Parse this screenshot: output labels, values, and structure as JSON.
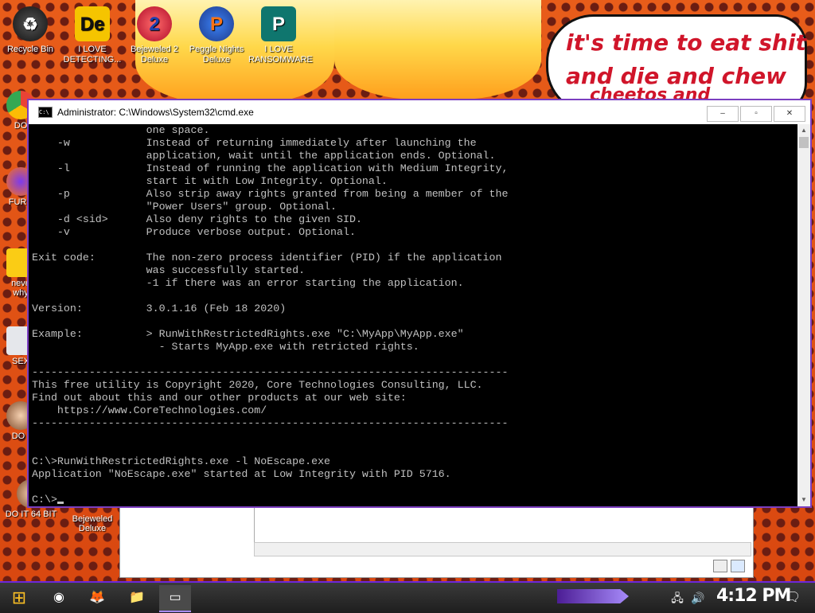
{
  "desktop": {
    "top_icons": [
      {
        "label": "Recycle Bin",
        "icon": "recycle-bin-icon",
        "glyph": "🗑"
      },
      {
        "label": "I LOVE DETECTING...",
        "icon": "detecting-app-icon",
        "glyph": "De"
      },
      {
        "label": "Bejeweled 2 Deluxe",
        "icon": "bejeweled-icon",
        "glyph": "2"
      },
      {
        "label": "Peggle Nights Deluxe",
        "icon": "peggle-icon",
        "glyph": "P"
      },
      {
        "label": "I LOVE RANSOMWARE",
        "icon": "ransomware-icon",
        "glyph": "P"
      }
    ],
    "left_icons": [
      {
        "label": "DO",
        "icon": "chrome-icon"
      },
      {
        "label": "FURR",
        "icon": "firefox-icon"
      },
      {
        "label": "neve why",
        "icon": "dc-icon"
      },
      {
        "label": "SEX",
        "icon": "h-app-icon"
      },
      {
        "label": "DO I",
        "icon": "face-icon"
      },
      {
        "label": "DO IT 64 BIT",
        "icon": "face-icon-2"
      },
      {
        "label": "Bejeweled Deluxe",
        "icon": "bejeweled-deluxe-icon"
      }
    ],
    "speech_bubble": {
      "line1": "it's time to eat shit",
      "line2": "and die and chew",
      "line3": "cheetos and"
    }
  },
  "cmd_window": {
    "title": "Administrator: C:\\Windows\\System32\\cmd.exe",
    "title_icon_text": "C:\\",
    "minimize": "–",
    "maximize": "▫",
    "close": "✕",
    "lines": [
      "                  one space.",
      "    -w            Instead of returning immediately after launching the",
      "                  application, wait until the application ends. Optional.",
      "    -l            Instead of running the application with Medium Integrity,",
      "                  start it with Low Integrity. Optional.",
      "    -p            Also strip away rights granted from being a member of the",
      "                  \"Power Users\" group. Optional.",
      "    -d <sid>      Also deny rights to the given SID.",
      "    -v            Produce verbose output. Optional.",
      "",
      "Exit code:        The non-zero process identifier (PID) if the application",
      "                  was successfully started.",
      "                  -1 if there was an error starting the application.",
      "",
      "Version:          3.0.1.16 (Feb 18 2020)",
      "",
      "Example:          > RunWithRestrictedRights.exe \"C:\\MyApp\\MyApp.exe\"",
      "                    - Starts MyApp.exe with retricted rights.",
      "",
      "---------------------------------------------------------------------------",
      "This free utility is Copyright 2020, Core Technologies Consulting, LLC.",
      "Find out about this and our other products at our web site:",
      "    https://www.CoreTechnologies.com/",
      "---------------------------------------------------------------------------",
      "",
      "",
      "C:\\>RunWithRestrictedRights.exe -l NoEscape.exe",
      "Application \"NoEscape.exe\" started at Low Integrity with PID 5716.",
      ""
    ],
    "prompt": "C:\\>"
  },
  "taskbar": {
    "start_glyph": "⊞",
    "items": [
      {
        "name": "chrome-taskbar-icon",
        "glyph": "◉"
      },
      {
        "name": "firefox-taskbar-icon",
        "glyph": "🦊"
      },
      {
        "name": "file-explorer-taskbar-icon",
        "glyph": "📁"
      },
      {
        "name": "cmd-taskbar-icon",
        "glyph": "▭"
      }
    ],
    "tray": {
      "network": "🖧",
      "volume": "🔊",
      "notification": "🗨"
    },
    "clock": "4:12 PM"
  }
}
